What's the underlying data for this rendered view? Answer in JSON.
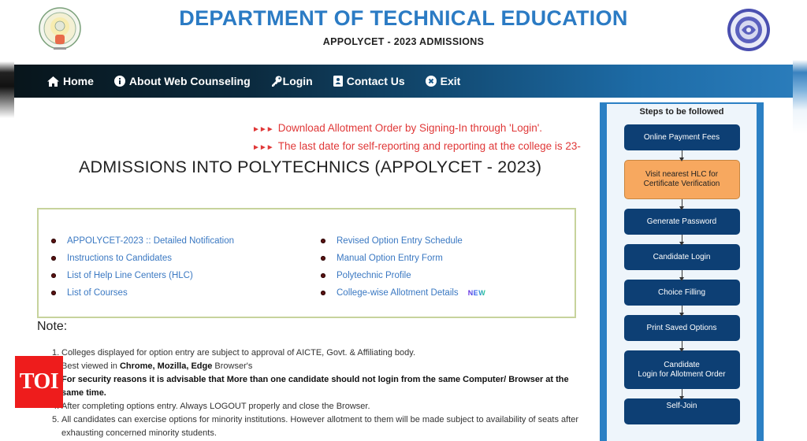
{
  "header": {
    "title": "DEPARTMENT OF TECHNICAL EDUCATION",
    "subtitle": "APPOLYCET - 2023 ADMISSIONS",
    "logo_left": "andhra-pradesh-emblem",
    "logo_right": "technical-education-seal"
  },
  "nav": {
    "items": [
      {
        "label": "Home",
        "icon": "home-icon"
      },
      {
        "label": "About Web Counseling",
        "icon": "info-icon"
      },
      {
        "label": "Login",
        "icon": "key-icon"
      },
      {
        "label": "Contact Us",
        "icon": "contact-card-icon"
      },
      {
        "label": "Exit",
        "icon": "close-circle-icon"
      }
    ]
  },
  "announcements": [
    "Download Allotment Order by Signing-In through 'Login'.",
    "The last date for self-reporting and reporting at the college is 23-"
  ],
  "announcement_arrow": "►►►",
  "main_heading": "ADMISSIONS INTO POLYTECHNICS (APPOLYCET - 2023)",
  "links": {
    "left": [
      "APPOLYCET-2023 :: Detailed Notification",
      "Instructions to Candidates",
      "List of Help Line Centers (HLC)",
      "List of Courses"
    ],
    "right": [
      "Revised Option Entry Schedule",
      "Manual Option Entry Form",
      "Polytechnic Profile",
      "College-wise Allotment Details"
    ],
    "new_badge": "NEW"
  },
  "notes": {
    "title": "Note:",
    "items": [
      {
        "num": "1.",
        "text": "Colleges displayed for option entry are subject to approval of AICTE, Govt. & Affiliating body."
      },
      {
        "num": "2.",
        "pre": "Best viewed in ",
        "bold": "Chrome, Mozilla, Edge",
        "post": " Browser's"
      },
      {
        "num": "3.",
        "text": "For security reasons it is advisable that More than one candidate should not login from the same Computer/ Browser at the same time."
      },
      {
        "num": "4.",
        "text": "After completing options entry. Always LOGOUT properly and close the Browser."
      },
      {
        "num": "5.",
        "text": "All candidates can exercise options for minority institutions. However allotment to them will be made subject to availability of seats after exhausting concerned minority students."
      }
    ]
  },
  "steps": {
    "title": "Steps to be followed",
    "items": [
      {
        "label": "Online Payment Fees",
        "highlight": false
      },
      {
        "label": "Visit nearest HLC for Certificate Verification",
        "highlight": true
      },
      {
        "label": "Generate Password",
        "highlight": false
      },
      {
        "label": "Candidate Login",
        "highlight": false
      },
      {
        "label": "Choice Filling",
        "highlight": false
      },
      {
        "label": "Print  Saved Options",
        "highlight": false
      },
      {
        "label": "Candidate\nLogin for Allotment Order",
        "highlight": false
      },
      {
        "label": "Self-Join",
        "highlight": false
      }
    ]
  },
  "watermark": "TOI",
  "colors": {
    "title_blue": "#2b7bc4",
    "announcement_red": "#e03838",
    "link_blue": "#3a78c2",
    "step_navy": "#0d3f74",
    "step_orange": "#f7a85f",
    "panel_border": "#2b80c4",
    "toi_red": "#ee1c1c"
  }
}
